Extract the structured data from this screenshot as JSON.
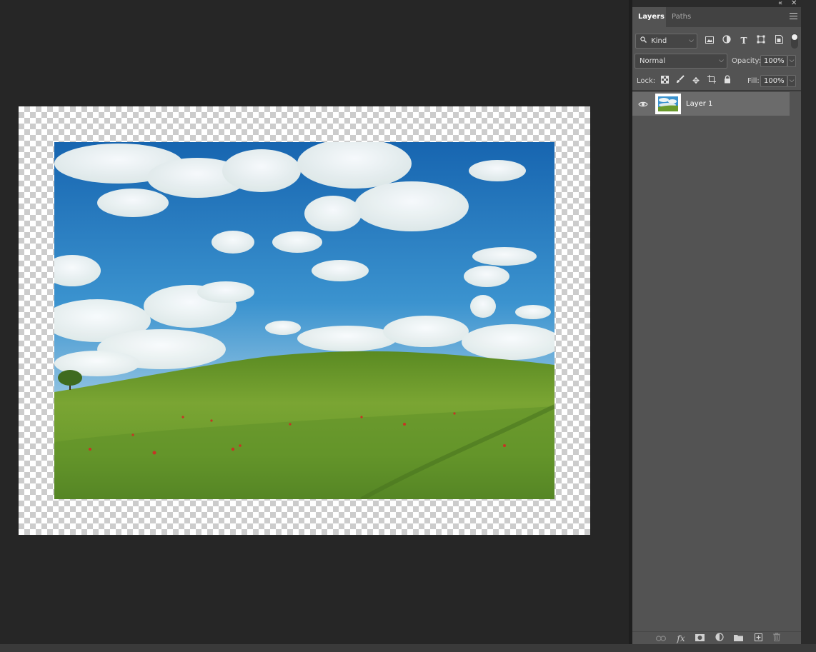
{
  "panel": {
    "tabs": [
      {
        "label": "Layers",
        "active": true
      },
      {
        "label": "Paths",
        "active": false
      }
    ],
    "filter": {
      "kind_label": "Kind",
      "icons": [
        "image-filter-icon",
        "adjustment-filter-icon",
        "type-filter-icon",
        "shape-filter-icon",
        "smart-object-filter-icon"
      ],
      "toggle_on": true
    },
    "blend_mode": "Normal",
    "opacity": {
      "label": "Opacity:",
      "value": "100%"
    },
    "lock": {
      "label": "Lock:",
      "icons": [
        "lock-transparent-pixels-icon",
        "lock-image-pixels-icon",
        "lock-position-icon",
        "lock-artboard-icon",
        "lock-all-icon"
      ]
    },
    "fill": {
      "label": "Fill:",
      "value": "100%"
    },
    "layers": [
      {
        "name": "Layer 1",
        "visible": true,
        "selected": true
      }
    ],
    "footer_icons": [
      "link-layers-icon",
      "layer-style-fx-icon",
      "add-mask-icon",
      "new-adjustment-layer-icon",
      "new-group-icon",
      "new-layer-icon",
      "delete-layer-icon"
    ]
  },
  "colors": {
    "workspace": "#262626",
    "panel": "#535353",
    "selected_layer": "#6b6b6b",
    "sky_top": "#1b6fb8",
    "grass": "#5f8f2a"
  }
}
